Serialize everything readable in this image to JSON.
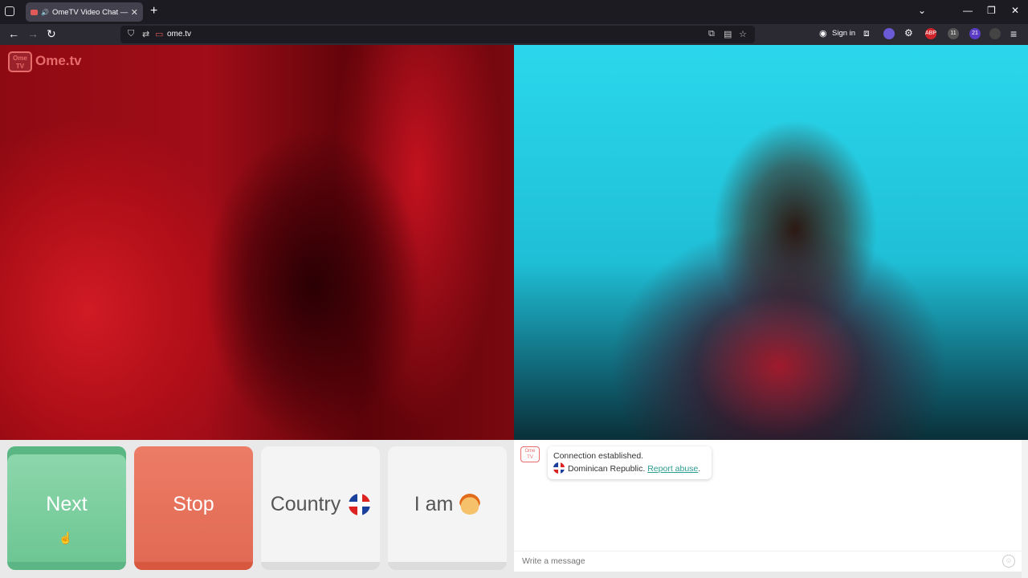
{
  "browser": {
    "tab_title": "OmeTV Video Chat — Ome.tv",
    "url": "ome.tv",
    "sign_in": "Sign in",
    "badge_1": "11",
    "badge_2": "21",
    "abp": "ABP"
  },
  "logo": {
    "box_text": "Ome TV",
    "text": "Ome.tv"
  },
  "controls": {
    "next": "Next",
    "stop": "Stop",
    "country": "Country",
    "i_am": "I am"
  },
  "chat": {
    "logo_text": "Ome TV",
    "status": "Connection established.",
    "country": "Dominican Republic.",
    "report": "Report abuse",
    "report_suffix": ".",
    "placeholder": "Write a message"
  },
  "colors": {
    "next": "#6dc693",
    "stop": "#e26a54",
    "accent": "#2a9d8f"
  }
}
